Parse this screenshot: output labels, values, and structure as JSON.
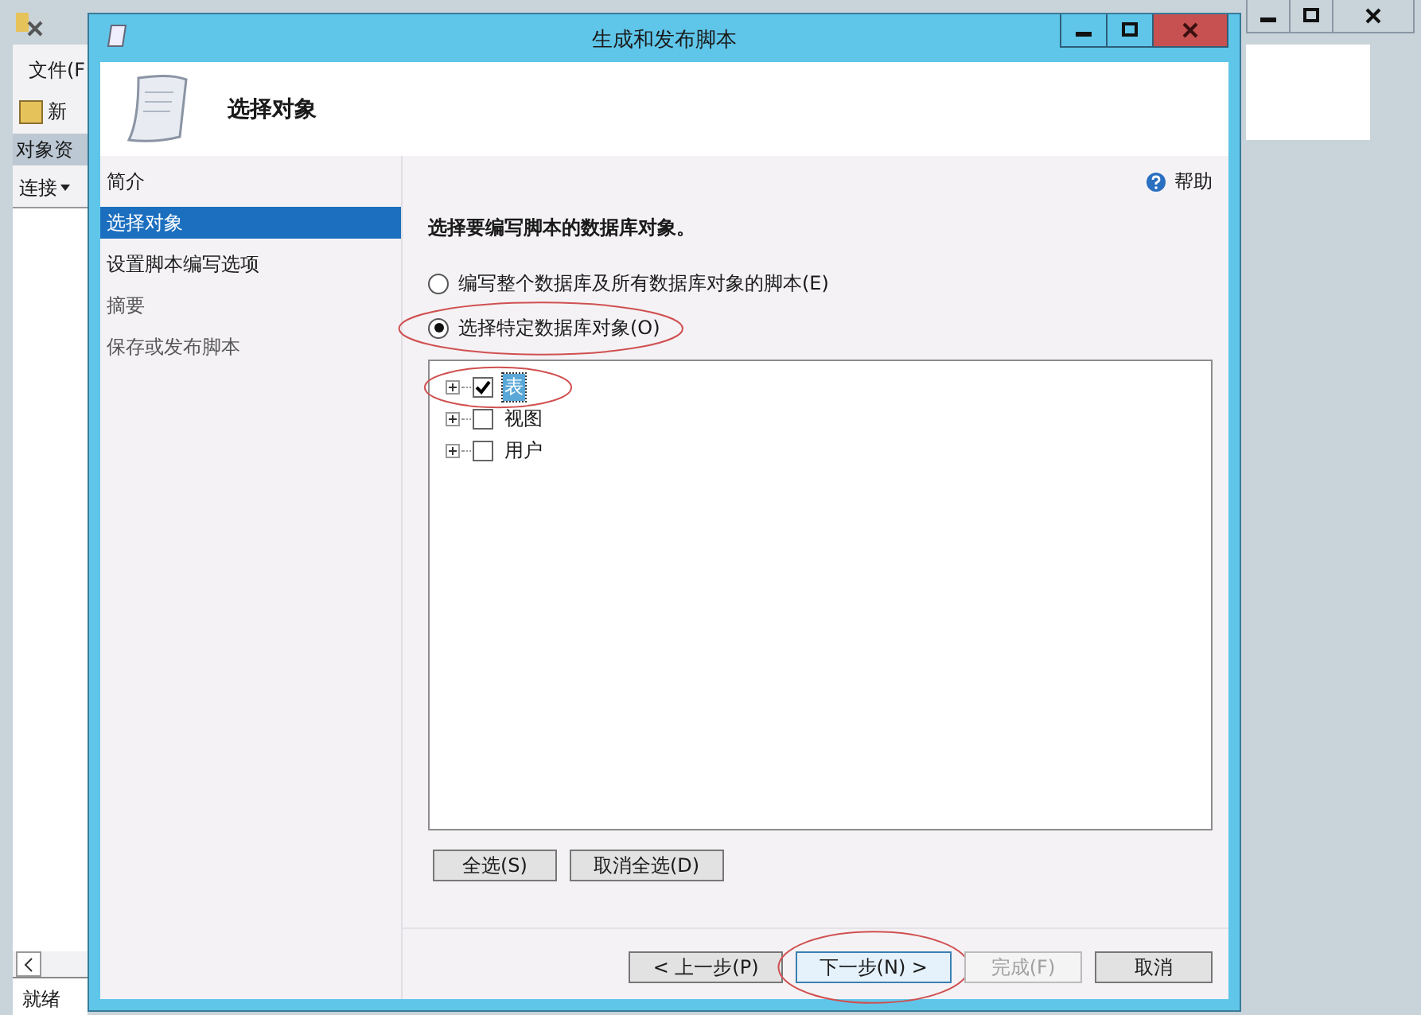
{
  "background_window": {
    "menu": "文件(F",
    "toolbar_button": "新",
    "panel_title": "对象资",
    "connect_button": "连接",
    "status": "就绪"
  },
  "dialog": {
    "title": "生成和发布脚本",
    "header": "选择对象",
    "help": "帮助",
    "nav": [
      {
        "label": "简介",
        "selected": false,
        "disabled": false
      },
      {
        "label": "选择对象",
        "selected": true,
        "disabled": false
      },
      {
        "label": "设置脚本编写选项",
        "selected": false,
        "disabled": false
      },
      {
        "label": "摘要",
        "selected": false,
        "disabled": true
      },
      {
        "label": "保存或发布脚本",
        "selected": false,
        "disabled": true
      }
    ],
    "prompt": "选择要编写脚本的数据库对象。",
    "options": [
      {
        "label": "编写整个数据库及所有数据库对象的脚本(E)",
        "selected": false,
        "circled": false
      },
      {
        "label": "选择特定数据库对象(O)",
        "selected": true,
        "circled": true
      }
    ],
    "tree": [
      {
        "label": "表",
        "checked": true,
        "selected": true,
        "circled": true
      },
      {
        "label": "视图",
        "checked": false,
        "selected": false,
        "circled": false
      },
      {
        "label": "用户",
        "checked": false,
        "selected": false,
        "circled": false
      }
    ],
    "select_buttons": [
      "全选(S)",
      "取消全选(D)"
    ],
    "nav_buttons": [
      {
        "label": "< 上一步(P)",
        "disabled": false,
        "focused": false,
        "circled": false
      },
      {
        "label": "下一步(N) >",
        "disabled": false,
        "focused": true,
        "circled": true
      },
      {
        "label": "完成(F)",
        "disabled": true,
        "focused": false,
        "circled": false
      },
      {
        "label": "取消",
        "disabled": false,
        "focused": false,
        "circled": false
      }
    ]
  }
}
